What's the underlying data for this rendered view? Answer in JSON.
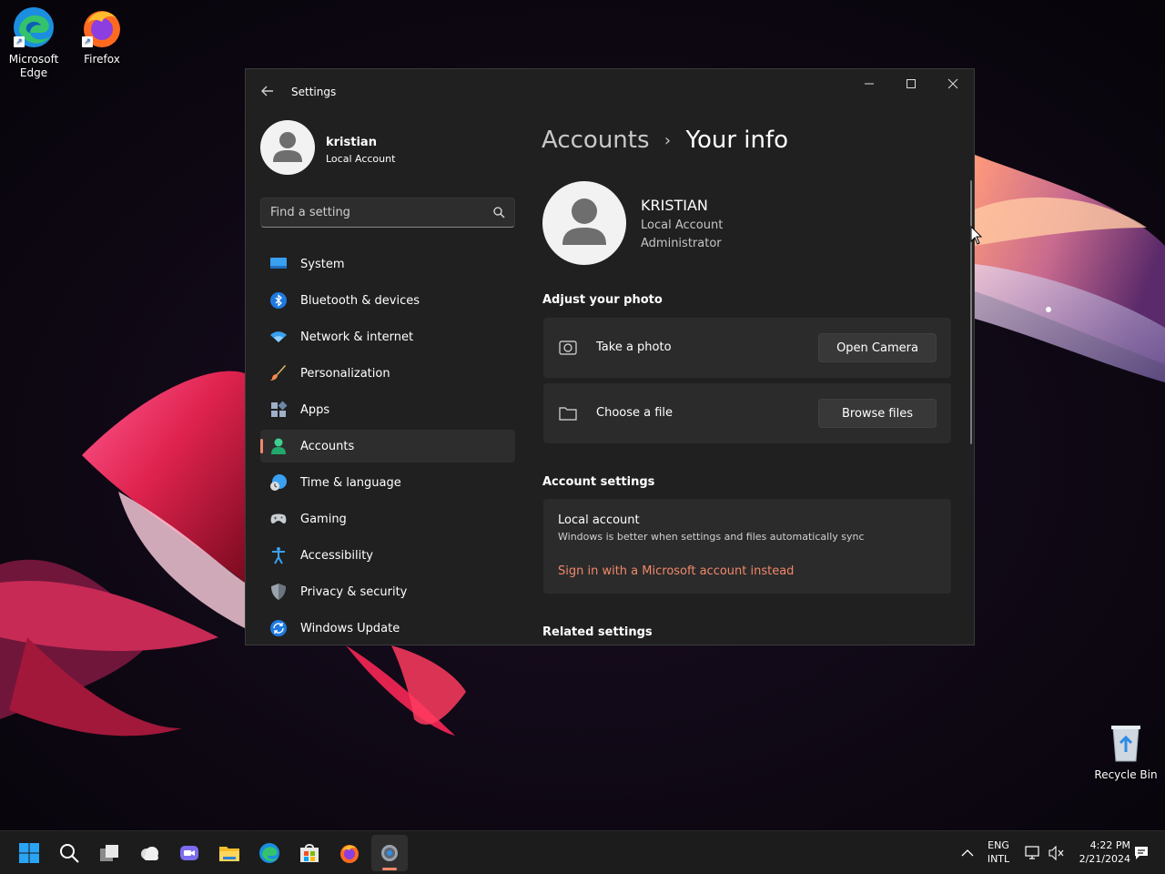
{
  "desktop": {
    "icons": [
      {
        "label": "Microsoft\nEdge",
        "label_line1": "Microsoft",
        "label_line2": "Edge"
      },
      {
        "label_line1": "Firefox"
      },
      {
        "label_line1": "Recycle Bin"
      }
    ]
  },
  "window": {
    "title": "Settings",
    "profile": {
      "name": "kristian",
      "type": "Local Account"
    },
    "search": {
      "placeholder": "Find a setting"
    },
    "nav": [
      {
        "label": "System",
        "icon": "monitor-icon"
      },
      {
        "label": "Bluetooth & devices",
        "icon": "bluetooth-icon"
      },
      {
        "label": "Network & internet",
        "icon": "wifi-icon"
      },
      {
        "label": "Personalization",
        "icon": "brush-icon"
      },
      {
        "label": "Apps",
        "icon": "apps-icon"
      },
      {
        "label": "Accounts",
        "icon": "person-icon",
        "active": true
      },
      {
        "label": "Time & language",
        "icon": "clock-globe-icon"
      },
      {
        "label": "Gaming",
        "icon": "gamepad-icon"
      },
      {
        "label": "Accessibility",
        "icon": "accessibility-icon"
      },
      {
        "label": "Privacy & security",
        "icon": "shield-icon"
      },
      {
        "label": "Windows Update",
        "icon": "update-icon"
      }
    ],
    "breadcrumb": {
      "parent": "Accounts",
      "separator": "›",
      "current": "Your info"
    },
    "user": {
      "name": "KRISTIAN",
      "type": "Local Account",
      "role": "Administrator"
    },
    "adjust_photo": {
      "title": "Adjust your photo",
      "take_photo": {
        "label": "Take a photo",
        "button": "Open Camera"
      },
      "choose_file": {
        "label": "Choose a file",
        "button": "Browse files"
      }
    },
    "account_settings": {
      "title": "Account settings",
      "local_account_title": "Local account",
      "local_account_desc": "Windows is better when settings and files automatically sync",
      "link": "Sign in with a Microsoft account instead"
    },
    "related_settings": {
      "title": "Related settings"
    }
  },
  "taskbar": {
    "language": {
      "line1": "ENG",
      "line2": "INTL"
    },
    "clock": {
      "time": "4:22 PM",
      "date": "2/21/2024"
    }
  },
  "colors": {
    "accent": "#f2886b",
    "window_bg": "#202020",
    "card_bg": "#2b2b2b",
    "taskbar_bg": "#1c1c1c"
  }
}
